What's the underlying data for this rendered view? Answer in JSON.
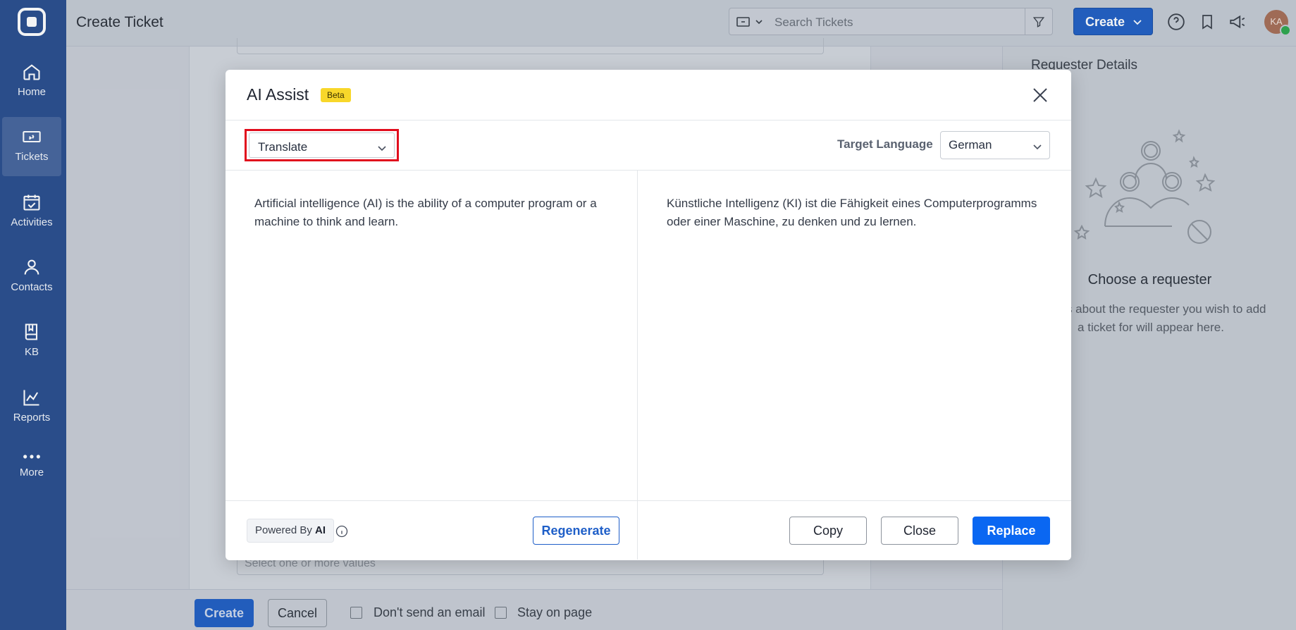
{
  "sidebar": {
    "items": [
      {
        "label": "Home",
        "icon": "home-icon"
      },
      {
        "label": "Tickets",
        "icon": "ticket-icon",
        "active": true
      },
      {
        "label": "Activities",
        "icon": "calendar-check-icon"
      },
      {
        "label": "Contacts",
        "icon": "person-icon"
      },
      {
        "label": "KB",
        "icon": "book-icon"
      },
      {
        "label": "Reports",
        "icon": "chart-line-icon"
      },
      {
        "label": "More",
        "icon": "more-dots-icon"
      }
    ]
  },
  "header": {
    "title": "Create Ticket",
    "search_placeholder": "Search Tickets",
    "create_label": "Create",
    "avatar_initials": "KA"
  },
  "background": {
    "select_placeholder": "Select one or more values",
    "requester": {
      "title": "Requester Details",
      "choose": "Choose a requester",
      "description": "Details about the requester you wish to add a ticket for will appear here."
    },
    "footer": {
      "create_label": "Create",
      "cancel_label": "Cancel",
      "dont_send_email": "Don't send an email",
      "stay_on_page": "Stay on page"
    }
  },
  "modal": {
    "title": "AI Assist",
    "badge": "Beta",
    "mode": "Translate",
    "target_language_label": "Target Language",
    "target_language": "German",
    "source_text": "Artificial intelligence (AI) is the ability of a computer program or a machine to think and learn.",
    "translated_text": "Künstliche Intelligenz (KI) ist die Fähigkeit eines Computerprogramms oder einer Maschine, zu denken und zu lernen.",
    "powered_by": "Powered By",
    "powered_by_strong": "AI",
    "regenerate_label": "Regenerate",
    "copy_label": "Copy",
    "close_label": "Close",
    "replace_label": "Replace"
  },
  "colors": {
    "sidebar": "#2b4f8f",
    "primary": "#0a67f2",
    "beta": "#f8d72a",
    "highlight": "#e10d1d"
  }
}
